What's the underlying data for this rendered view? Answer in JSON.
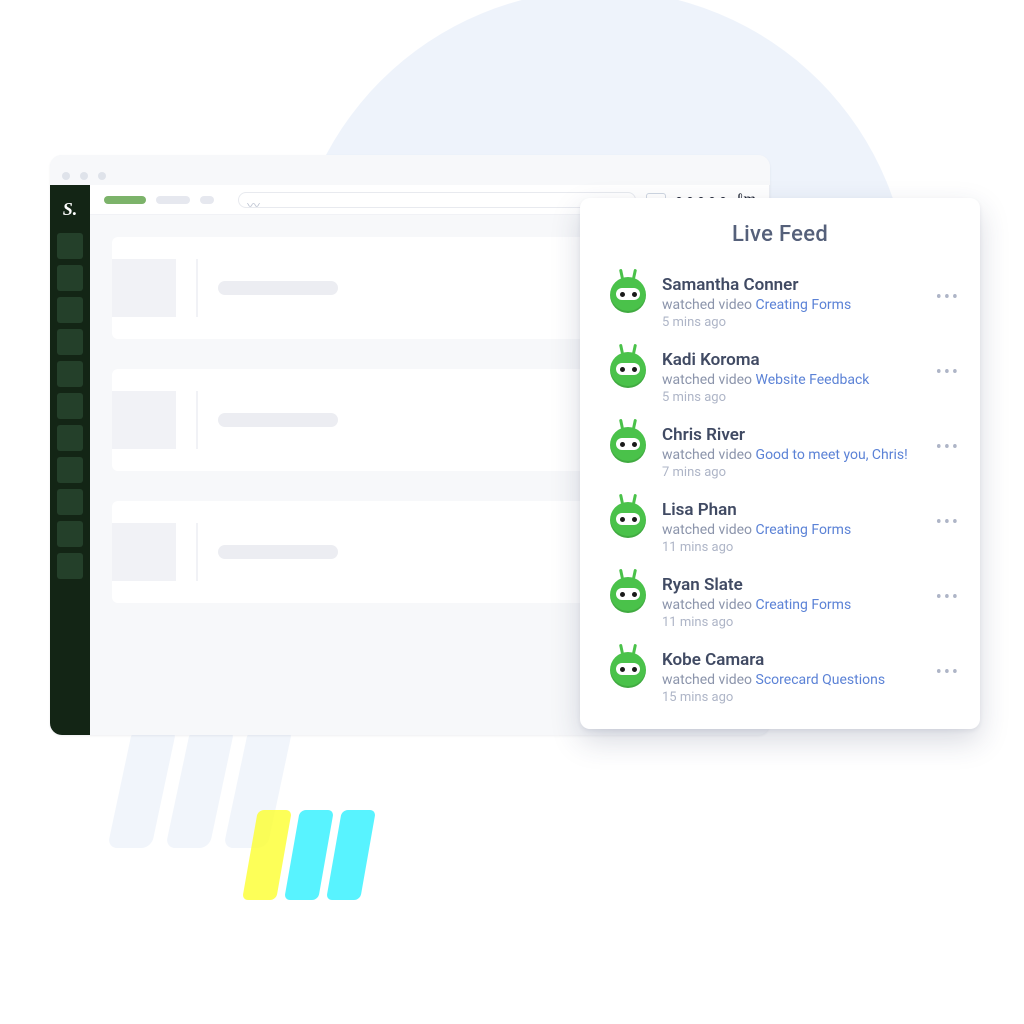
{
  "sidebar": {
    "logo_text": "S."
  },
  "live_feed": {
    "title": "Live Feed",
    "action_label": "watched video",
    "items": [
      {
        "name": "Samantha Conner",
        "video": "Creating Forms",
        "time": "5 mins ago"
      },
      {
        "name": "Kadi Koroma",
        "video": "Website Feedback",
        "time": "5 mins ago"
      },
      {
        "name": "Chris River",
        "video": "Good to meet you, Chris!",
        "time": "7 mins ago"
      },
      {
        "name": "Lisa Phan",
        "video": "Creating Forms",
        "time": "11 mins ago"
      },
      {
        "name": "Ryan Slate",
        "video": "Creating Forms",
        "time": "11 mins ago"
      },
      {
        "name": "Kobe Camara",
        "video": "Scorecard Questions",
        "time": "15 mins ago"
      }
    ]
  }
}
